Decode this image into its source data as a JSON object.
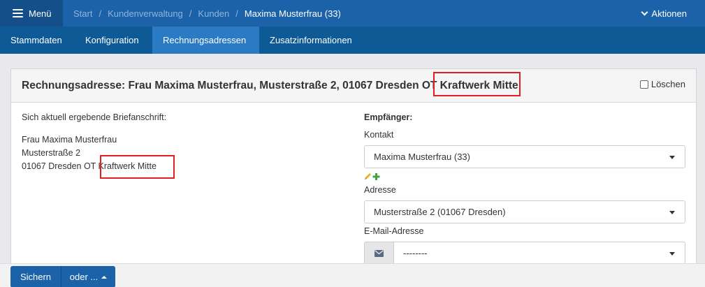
{
  "topbar": {
    "menu_label": "Menü",
    "breadcrumb": [
      "Start",
      "Kundenverwaltung",
      "Kunden"
    ],
    "breadcrumb_separator": "/",
    "current_page": "Maxima Musterfrau (33)",
    "actions_label": "Aktionen"
  },
  "tabs": [
    {
      "label": "Stammdaten",
      "active": false
    },
    {
      "label": "Konfiguration",
      "active": false
    },
    {
      "label": "Rechnungsadressen",
      "active": true
    },
    {
      "label": "Zusatzinformationen",
      "active": false
    }
  ],
  "panel": {
    "title": "Rechnungsadresse: Frau Maxima Musterfrau, Musterstraße 2, 01067 Dresden OT Kraftwerk Mitte",
    "delete_label": "Löschen",
    "delete_checked": false,
    "letter_label": "Sich aktuell ergebende Briefanschrift:",
    "letter_lines": [
      "Frau Maxima Musterfrau",
      "Musterstraße 2",
      "01067 Dresden OT Kraftwerk Mitte"
    ],
    "recipient_label": "Empfänger:",
    "contact_label": "Kontakt",
    "contact_value": "Maxima Musterfrau (33)",
    "address_label": "Adresse",
    "address_value": "Musterstraße 2 (01067 Dresden)",
    "email_label": "E-Mail-Adresse",
    "email_value": "--------"
  },
  "footer": {
    "save_label": "Sichern",
    "more_label": "oder ..."
  },
  "colors": {
    "topbar": "#1b62a8",
    "tabbar": "#0d5a96",
    "active_tab": "#2a7bc3",
    "highlight": "#e02020",
    "edit_icon": "#e8b41c",
    "add_icon": "#3fa53f"
  },
  "icons": [
    "menu-icon",
    "chevron-down-icon",
    "edit-pencil-icon",
    "add-plus-icon",
    "envelope-icon",
    "caret-down-icon",
    "caret-up-icon"
  ]
}
